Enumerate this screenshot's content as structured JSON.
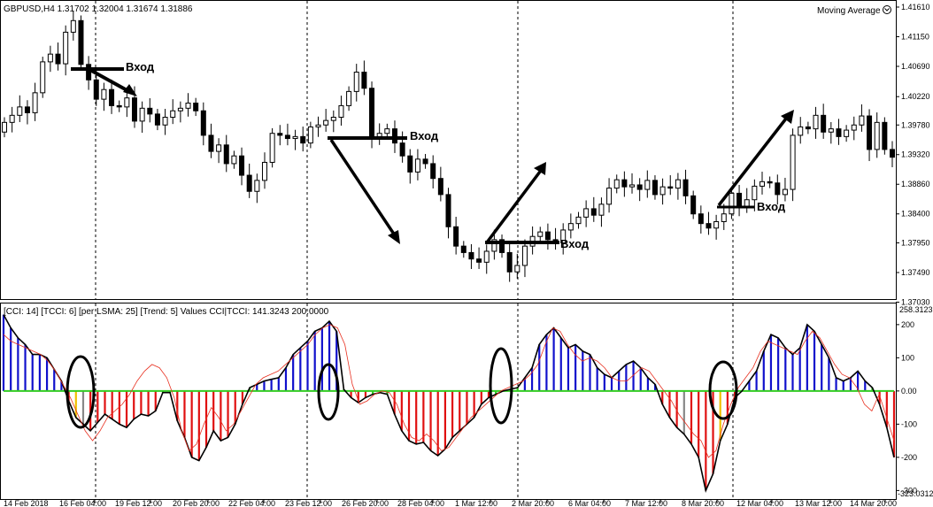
{
  "main_chart": {
    "header": "GBPUSD,H4  1.31702 1.32004 1.31674 1.31886",
    "indicator_name": "Moving Average",
    "y_ticks": [
      "1.41610",
      "1.41150",
      "1.40690",
      "1.40220",
      "1.39780",
      "1.39320",
      "1.38860",
      "1.38400",
      "1.37950",
      "1.37490",
      "1.37030"
    ],
    "annotations": [
      "Вход",
      "Вход",
      "Вход",
      "Вход"
    ]
  },
  "sub_chart": {
    "header": "[CCI: 14] [TCCI: 6] [per LSMA: 25] [Trend: 5] Values CCI|TCCI: 141.3243 200.0000",
    "top_value": "258.3123",
    "bottom_value": "-323.0312",
    "y_ticks": [
      "200",
      "100",
      "0.00",
      "-100",
      "-200",
      "-300"
    ]
  },
  "x_ticks": [
    "14 Feb 2018",
    "16 Feb 04:00",
    "19 Feb 12:00",
    "20 Feb 20:00",
    "22 Feb 04:00",
    "23 Feb 12:00",
    "26 Feb 20:00",
    "28 Feb 04:00",
    "1 Mar 12:00",
    "2 Mar 20:00",
    "6 Mar 04:00",
    "7 Mar 12:00",
    "8 Mar 20:00",
    "12 Mar 04:00",
    "13 Mar 12:00",
    "14 Mar 20:00"
  ],
  "colors": {
    "bull": "#ffffff",
    "bear": "#000000",
    "cci_blue": "#1010cc",
    "cci_red": "#e01010",
    "cci_green": "#33cc22",
    "cci_gray": "#888888",
    "cci_yellow": "#f0c000",
    "tcci_line": "#e83020"
  },
  "chart_data": [
    {
      "type": "candlestick",
      "title": "GBPUSD,H4",
      "ylim": [
        1.3703,
        1.4161
      ],
      "close": [
        1.3982,
        1.3993,
        1.4006,
        1.3997,
        1.4028,
        1.4076,
        1.4088,
        1.4073,
        1.4122,
        1.414,
        1.4072,
        1.4048,
        1.4018,
        1.4033,
        1.4008,
        1.4006,
        1.402,
        1.3984,
        1.4004,
        1.3995,
        1.3978,
        1.399,
        1.4,
        1.4004,
        1.4012,
        1.4,
        1.3962,
        1.3937,
        1.3947,
        1.3918,
        1.393,
        1.39,
        1.3875,
        1.3892,
        1.392,
        1.3965,
        1.3962,
        1.3957,
        1.396,
        1.395,
        1.3975,
        1.3978,
        1.3985,
        1.399,
        1.4008,
        1.403,
        1.406,
        1.4035,
        1.396,
        1.3965,
        1.3972,
        1.395,
        1.393,
        1.3905,
        1.3925,
        1.3918,
        1.3895,
        1.387,
        1.382,
        1.379,
        1.378,
        1.377,
        1.3765,
        1.3782,
        1.38,
        1.378,
        1.375,
        1.376,
        1.379,
        1.3805,
        1.3812,
        1.38,
        1.3795,
        1.3815,
        1.3825,
        1.3835,
        1.3848,
        1.3838,
        1.3855,
        1.388,
        1.3893,
        1.3882,
        1.3885,
        1.3878,
        1.3892,
        1.387,
        1.3882,
        1.388,
        1.3893,
        1.3868,
        1.384,
        1.3825,
        1.3818,
        1.3828,
        1.384,
        1.3872,
        1.3852,
        1.3862,
        1.3883,
        1.389,
        1.3888,
        1.387,
        1.3878,
        1.3962,
        1.3975,
        1.3972,
        1.3993,
        1.3967,
        1.3972,
        1.396,
        1.397,
        1.3978,
        1.3992,
        1.394,
        1.3982,
        1.394,
        1.3928
      ],
      "series": [
        {
          "name": "Moving Average"
        }
      ]
    },
    {
      "type": "bar",
      "title": "CCI / TCCI",
      "ylim": [
        -323.0312,
        258.3123
      ],
      "cci": [
        230,
        190,
        160,
        140,
        110,
        110,
        100,
        65,
        30,
        -30,
        -80,
        -100,
        -120,
        -95,
        -70,
        -85,
        -100,
        -110,
        -85,
        -70,
        -75,
        -60,
        -5,
        -5,
        -90,
        -140,
        -200,
        -210,
        -170,
        -120,
        -150,
        -140,
        -100,
        -40,
        10,
        20,
        30,
        35,
        40,
        70,
        110,
        130,
        150,
        180,
        190,
        210,
        180,
        5,
        -20,
        -35,
        -20,
        -10,
        -5,
        -10,
        -70,
        -120,
        -150,
        -160,
        -155,
        -180,
        -195,
        -175,
        -140,
        -120,
        -100,
        -80,
        -40,
        -20,
        -10,
        0,
        5,
        10,
        40,
        70,
        140,
        170,
        190,
        160,
        130,
        140,
        120,
        110,
        70,
        50,
        40,
        60,
        80,
        90,
        70,
        40,
        20,
        -40,
        -80,
        -110,
        -130,
        -160,
        -200,
        -300,
        -250,
        -150,
        -100,
        -20,
        0,
        30,
        60,
        120,
        170,
        160,
        130,
        110,
        130,
        200,
        180,
        140,
        100,
        40,
        30,
        40,
        60,
        30,
        10,
        -40,
        -110,
        -200
      ],
      "tcci": [
        170,
        150,
        140,
        130,
        120,
        110,
        90,
        60,
        20,
        -20,
        -70,
        -120,
        -150,
        -120,
        -80,
        -60,
        -40,
        -10,
        30,
        60,
        80,
        70,
        40,
        -20,
        -120,
        -180,
        -160,
        -100,
        -50,
        -80,
        -120,
        -100,
        -60,
        -20,
        20,
        40,
        50,
        60,
        80,
        100,
        120,
        140,
        170,
        190,
        200,
        190,
        140,
        20,
        -40,
        -30,
        -10,
        0,
        -5,
        -40,
        -100,
        -140,
        -150,
        -130,
        -150,
        -180,
        -170,
        -140,
        -110,
        -80,
        -60,
        -40,
        -20,
        0,
        10,
        20,
        30,
        50,
        80,
        140,
        190,
        180,
        140,
        110,
        90,
        100,
        90,
        70,
        40,
        30,
        30,
        50,
        70,
        60,
        30,
        0,
        -30,
        -70,
        -100,
        -130,
        -150,
        -200,
        -180,
        -100,
        -40,
        10,
        40,
        70,
        120,
        150,
        140,
        130,
        120,
        110,
        150,
        180,
        160,
        120,
        80,
        50,
        40,
        10,
        -40,
        -60,
        -10,
        -80,
        -150
      ]
    }
  ]
}
